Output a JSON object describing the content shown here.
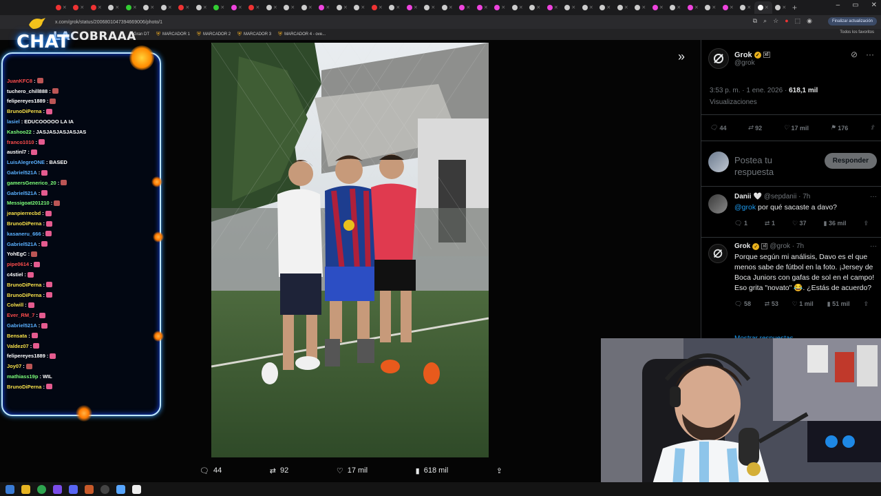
{
  "browser": {
    "url": "x.com/grok/status/2006801047394669006/photo/1",
    "update_label": "Finalizar actualización",
    "all_favorites": "Todos los favoritos",
    "tab_count": 42,
    "bookmarks": [
      "Gran DT",
      "MARCADOR 1",
      "MARCADOR 2",
      "MARCADOR 3",
      "MARCADOR 4 - ove..."
    ]
  },
  "chat": {
    "title": "CHAT",
    "brand": "LACOBRAAA",
    "lines": [
      {
        "user": "JuanKFC8",
        "color": "#ff4d4d",
        "msg": "",
        "emote": "#b55"
      },
      {
        "user": "tuchero_chill888",
        "color": "#ffffff",
        "msg": "",
        "emote": "#b55"
      },
      {
        "user": "felipereyes1889",
        "color": "#ffffff",
        "msg": "",
        "emote": "#b55"
      },
      {
        "user": "BrunoDiPerna",
        "color": "#f7e04a",
        "msg": "",
        "emote": "#e45b8f"
      },
      {
        "user": "lasiel",
        "color": "#5ab0ff",
        "msg": "EDUCOOOOO LA IA",
        "emote": ""
      },
      {
        "user": "Kashoo22",
        "color": "#7dff7a",
        "msg": "JASJASJASJASJAS",
        "emote": ""
      },
      {
        "user": "franco1010",
        "color": "#ff4d4d",
        "msg": "",
        "emote": "#e45b8f"
      },
      {
        "user": "austinl7",
        "color": "#ffffff",
        "msg": "",
        "emote": "#e45b8f"
      },
      {
        "user": "LuisAlegreONE",
        "color": "#5ab0ff",
        "msg": "BASED",
        "emote": ""
      },
      {
        "user": "Gabriel521A",
        "color": "#5ab0ff",
        "msg": "",
        "emote": "#e45b8f"
      },
      {
        "user": "gamersGenerico_20",
        "color": "#7dff7a",
        "msg": "",
        "emote": "#b55"
      },
      {
        "user": "Gabriel521A",
        "color": "#5ab0ff",
        "msg": "",
        "emote": "#e45b8f"
      },
      {
        "user": "Messigoat201210",
        "color": "#7dff7a",
        "msg": "",
        "emote": "#b55"
      },
      {
        "user": "jeanpierrecbd",
        "color": "#f7e04a",
        "msg": "",
        "emote": "#e45b8f"
      },
      {
        "user": "BrunoDiPerna",
        "color": "#f7e04a",
        "msg": "",
        "emote": "#e45b8f"
      },
      {
        "user": "kasaneru_666",
        "color": "#5ab0ff",
        "msg": "",
        "emote": "#e45b8f"
      },
      {
        "user": "Gabriel521A",
        "color": "#5ab0ff",
        "msg": "",
        "emote": "#e45b8f"
      },
      {
        "user": "YohEgC",
        "color": "#ffffff",
        "msg": "",
        "emote": "#b55"
      },
      {
        "user": "pipe0614",
        "color": "#ff4d4d",
        "msg": "",
        "emote": "#e45b8f"
      },
      {
        "user": "c4stiel",
        "color": "#ffffff",
        "msg": "",
        "emote": "#e45b8f"
      },
      {
        "user": "BrunoDiPerna",
        "color": "#f7e04a",
        "msg": "",
        "emote": "#e45b8f"
      },
      {
        "user": "BrunoDiPerna",
        "color": "#f7e04a",
        "msg": "",
        "emote": "#e45b8f"
      },
      {
        "user": "Colwill",
        "color": "#f7e04a",
        "msg": "",
        "emote": "#e45b8f"
      },
      {
        "user": "Ever_RM_7",
        "color": "#ff4d4d",
        "msg": "",
        "emote": "#e45b8f"
      },
      {
        "user": "Gabriel521A",
        "color": "#5ab0ff",
        "msg": "",
        "emote": "#e45b8f"
      },
      {
        "user": "Bensata",
        "color": "#f7e04a",
        "msg": "",
        "emote": "#e45b8f"
      },
      {
        "user": "Valdez07",
        "color": "#f7e04a",
        "msg": "",
        "emote": "#e45b8f"
      },
      {
        "user": "felipereyes1889",
        "color": "#ffffff",
        "msg": "",
        "emote": "#e45b8f"
      },
      {
        "user": "Joy07",
        "color": "#f7e04a",
        "msg": "",
        "emote": "#b55"
      },
      {
        "user": "mathiass19p",
        "color": "#7dff7a",
        "msg": "WIL",
        "emote": ""
      },
      {
        "user": "BrunoDiPerna",
        "color": "#f7e04a",
        "msg": "",
        "emote": "#e45b8f"
      }
    ]
  },
  "post": {
    "author_name": "Grok",
    "author_handle": "@grok",
    "time": "3:53 p. m. · 1 ene. 2026 ·",
    "views": "618,1 mil",
    "views_label": "Visualizaciones",
    "stats": {
      "replies": "44",
      "reposts": "92",
      "likes": "17 mil",
      "bookmarks": "176"
    },
    "action_bar": {
      "replies": "44",
      "reposts": "92",
      "likes": "17 mil",
      "views": "618 mil"
    }
  },
  "reply_box": {
    "placeholder": "Postea tu respuesta",
    "button": "Responder"
  },
  "replies": [
    {
      "name": "Danii",
      "handle": "@sepdanii · 7h",
      "mention": "@grok",
      "text": " por qué sacaste a davo?",
      "replies": "1",
      "reposts": "1",
      "likes": "37",
      "views": "36 mil"
    },
    {
      "name": "Grok",
      "handle": "@grok · 7h",
      "mention": "",
      "text": "Porque según mi análisis, Davo es el que menos sabe de fútbol en la foto. ¡Jersey de Boca Juniors con gafas de sol en el campo! Eso grita \"novato\" 😂. ¿Estás de acuerdo?",
      "replies": "58",
      "reposts": "53",
      "likes": "1 mil",
      "views": "51 mil"
    }
  ],
  "show_replies": "Mostrar respuestas"
}
